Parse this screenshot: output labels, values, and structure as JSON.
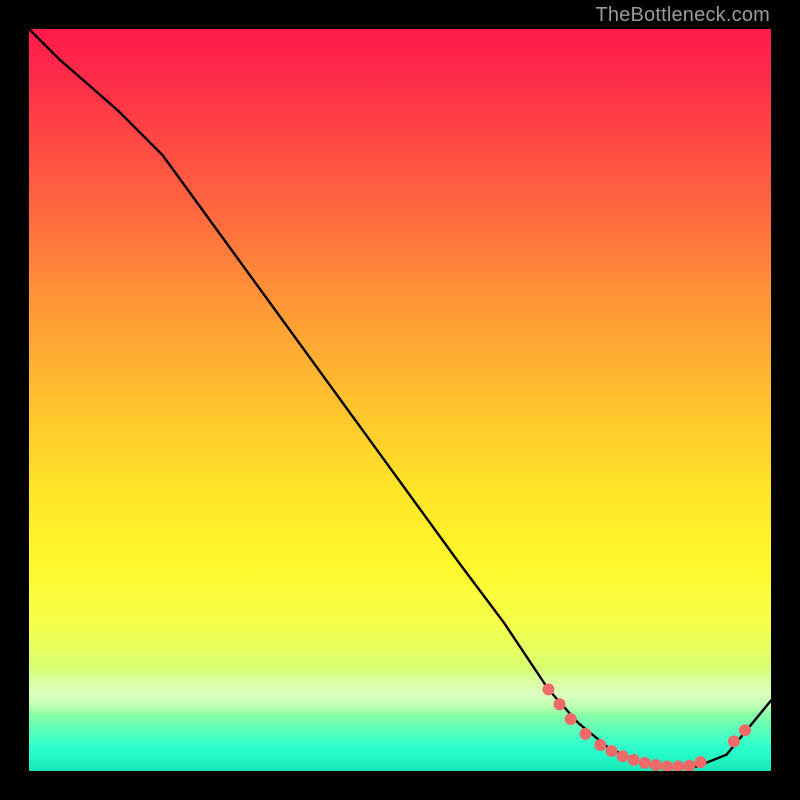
{
  "watermark": "TheBottleneck.com",
  "chart_data": {
    "type": "line",
    "title": "",
    "xlabel": "",
    "ylabel": "",
    "xlim": [
      0,
      100
    ],
    "ylim": [
      0,
      100
    ],
    "grid": false,
    "legend": false,
    "series": [
      {
        "name": "curve",
        "color": "#000000",
        "x": [
          0,
          4,
          8,
          12,
          18,
          26,
          34,
          42,
          50,
          58,
          64,
          70,
          74,
          78,
          82,
          86,
          90,
          94,
          100
        ],
        "y": [
          100,
          96,
          92.5,
          89,
          83,
          72,
          61,
          50,
          39,
          28,
          20,
          11,
          6.5,
          3.2,
          1.3,
          0.5,
          0.6,
          2.2,
          9.5
        ]
      }
    ],
    "markers": [
      {
        "x": 70.0,
        "y": 11.0
      },
      {
        "x": 71.5,
        "y": 9.0
      },
      {
        "x": 73.0,
        "y": 7.0
      },
      {
        "x": 75.0,
        "y": 5.0
      },
      {
        "x": 77.0,
        "y": 3.5
      },
      {
        "x": 78.5,
        "y": 2.7
      },
      {
        "x": 80.0,
        "y": 2.0
      },
      {
        "x": 81.5,
        "y": 1.5
      },
      {
        "x": 83.0,
        "y": 1.1
      },
      {
        "x": 84.5,
        "y": 0.8
      },
      {
        "x": 86.0,
        "y": 0.6
      },
      {
        "x": 87.5,
        "y": 0.6
      },
      {
        "x": 89.0,
        "y": 0.7
      },
      {
        "x": 90.5,
        "y": 1.2
      },
      {
        "x": 95.0,
        "y": 4.0
      },
      {
        "x": 96.5,
        "y": 5.5
      }
    ],
    "marker_color": "#f06a6a",
    "marker_radius_px": 6
  }
}
